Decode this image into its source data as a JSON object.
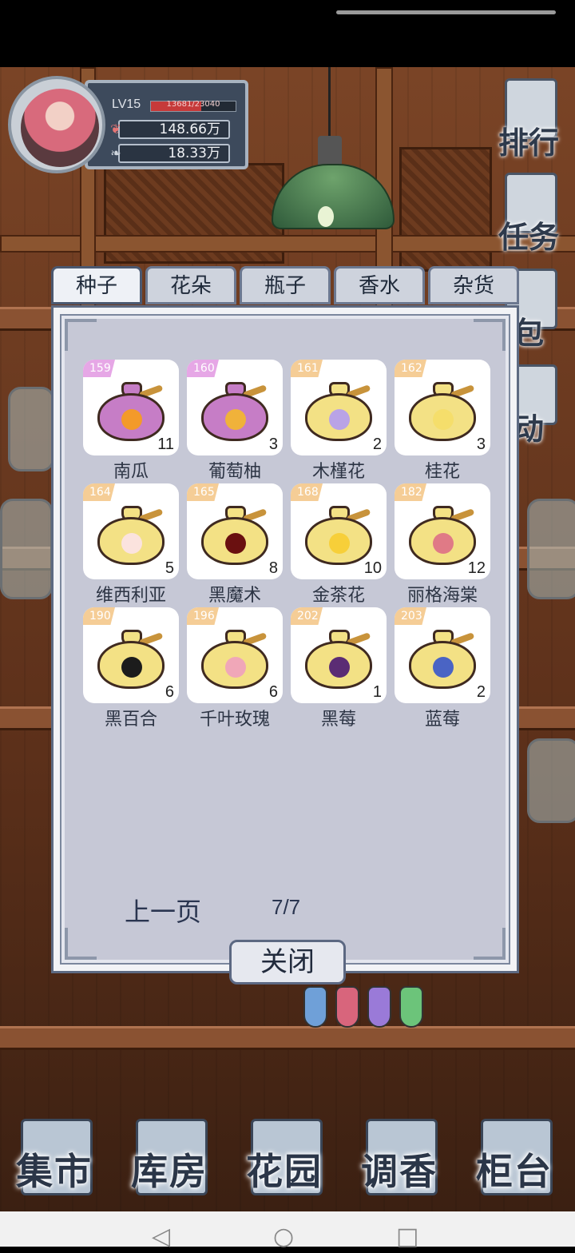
{
  "player": {
    "level": "LV15",
    "exp_text": "13681/23040",
    "exp_fraction": 0.594,
    "currency1": "148.66万",
    "currency2": "18.33万"
  },
  "side_menu": [
    "排行",
    "任务",
    "包",
    "动"
  ],
  "tabs": [
    "种子",
    "花朵",
    "瓶子",
    "香水",
    "杂货"
  ],
  "active_tab": "种子",
  "items": [
    {
      "id": "159",
      "name": "南瓜",
      "count": "11",
      "badge": "pink",
      "bag": "purple",
      "art": "#f39a2a"
    },
    {
      "id": "160",
      "name": "葡萄柚",
      "count": "3",
      "badge": "pink",
      "bag": "purple",
      "art": "#f0b23a"
    },
    {
      "id": "161",
      "name": "木槿花",
      "count": "2",
      "badge": "orange",
      "bag": "yellow",
      "art": "#b9a3e6"
    },
    {
      "id": "162",
      "name": "桂花",
      "count": "3",
      "badge": "orange",
      "bag": "yellow",
      "art": "#f5de6b"
    },
    {
      "id": "164",
      "name": "维西利亚",
      "count": "5",
      "badge": "orange",
      "bag": "yellow",
      "art": "#fbe3de"
    },
    {
      "id": "165",
      "name": "黑魔术",
      "count": "8",
      "badge": "orange",
      "bag": "yellow",
      "art": "#6a1010"
    },
    {
      "id": "168",
      "name": "金茶花",
      "count": "10",
      "badge": "orange",
      "bag": "yellow",
      "art": "#f7cf39"
    },
    {
      "id": "182",
      "name": "丽格海棠",
      "count": "12",
      "badge": "orange",
      "bag": "yellow",
      "art": "#e07a86"
    },
    {
      "id": "190",
      "name": "黑百合",
      "count": "6",
      "badge": "orange",
      "bag": "yellow",
      "art": "#1c1c1c"
    },
    {
      "id": "196",
      "name": "千叶玫瑰",
      "count": "6",
      "badge": "orange",
      "bag": "yellow",
      "art": "#f0a7b8"
    },
    {
      "id": "202",
      "name": "黑莓",
      "count": "1",
      "badge": "orange",
      "bag": "yellow",
      "art": "#5b2c74"
    },
    {
      "id": "203",
      "name": "蓝莓",
      "count": "2",
      "badge": "orange",
      "bag": "yellow",
      "art": "#4a64c4"
    }
  ],
  "pagination": {
    "prev_label": "上一页",
    "page": "7/7"
  },
  "close_label": "关闭",
  "bottom_nav": [
    "集市",
    "库房",
    "花园",
    "调香",
    "柜台"
  ],
  "system_nav": {
    "back": "◁",
    "home": "○",
    "recents": "□"
  }
}
